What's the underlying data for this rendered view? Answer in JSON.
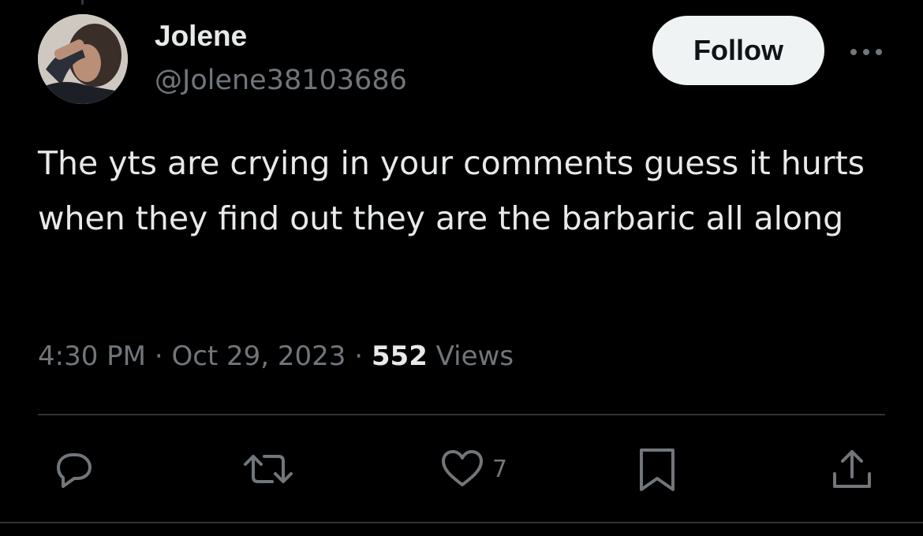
{
  "user": {
    "display_name": "Jolene",
    "handle": "@Jolene38103686",
    "avatar": "profile-photo"
  },
  "header": {
    "follow_label": "Follow",
    "more_icon": "more-horizontal-icon"
  },
  "tweet": {
    "text": "The yts are crying in your comments guess it hurts when they find out they are the barbaric all along",
    "time": "4:30 PM",
    "separator": "·",
    "date": "Oct 29, 2023",
    "views_count": "552",
    "views_label": "Views"
  },
  "actions": {
    "reply_icon": "reply-icon",
    "retweet_icon": "retweet-icon",
    "like_icon": "heart-icon",
    "like_count": "7",
    "bookmark_icon": "bookmark-icon",
    "share_icon": "share-icon"
  },
  "colors": {
    "background": "#000000",
    "text_primary": "#e7e9ea",
    "text_secondary": "#71767b",
    "divider": "#2f3336",
    "follow_bg": "#eff3f4",
    "follow_text": "#0f1419"
  }
}
